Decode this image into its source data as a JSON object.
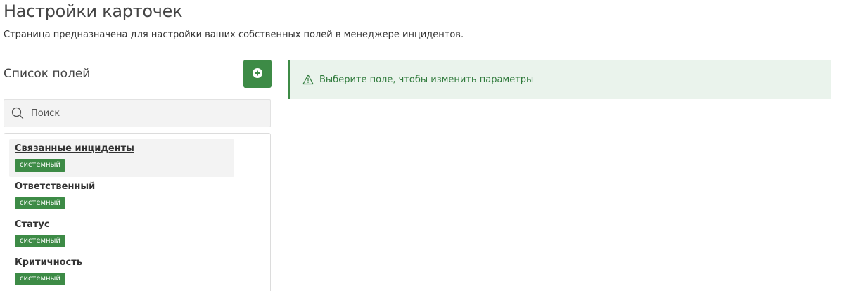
{
  "page": {
    "title": "Настройки карточек",
    "subtitle": "Страница предназначена для настройки ваших собственных полей в менеджере инцидентов."
  },
  "fields_panel": {
    "title": "Список полей",
    "add_button_icon": "plus-circle-icon",
    "search": {
      "placeholder": "Поиск",
      "value": "",
      "icon": "search-icon"
    },
    "items": [
      {
        "name": "Связанные инциденты",
        "badge": "системный",
        "selected": true
      },
      {
        "name": "Ответственный",
        "badge": "системный",
        "selected": false
      },
      {
        "name": "Статус",
        "badge": "системный",
        "selected": false
      },
      {
        "name": "Критичность",
        "badge": "системный",
        "selected": false
      }
    ]
  },
  "alert": {
    "icon": "warning-triangle-icon",
    "text": "Выберите поле, чтобы изменить параметры"
  },
  "colors": {
    "accent": "#3d8b46",
    "alert_background": "#eaf3ec",
    "alert_text": "#2f7a3b"
  }
}
